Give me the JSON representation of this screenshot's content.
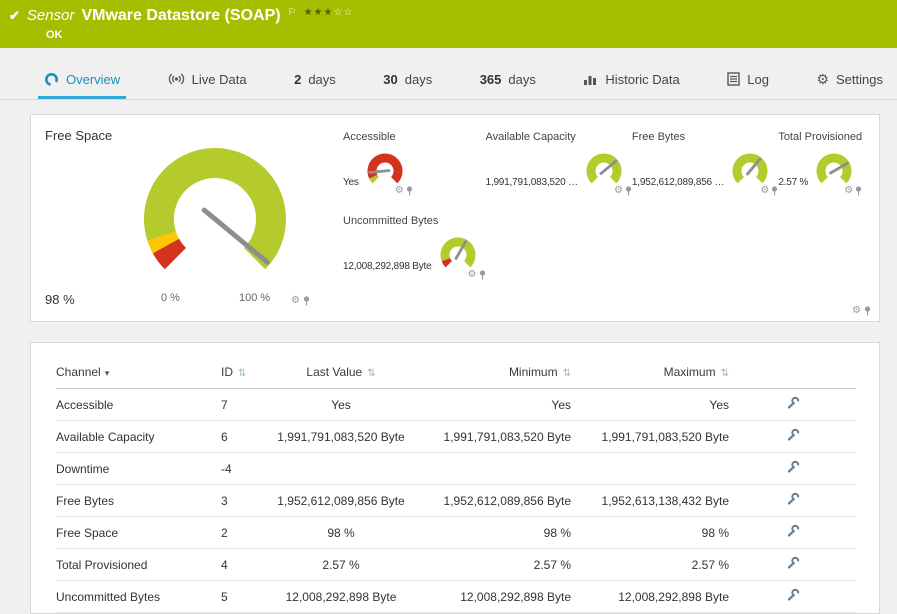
{
  "header": {
    "kind_label": "Sensor",
    "title": "VMware Datastore (SOAP)",
    "status": "OK",
    "priority_filled": "★★★",
    "priority_empty": "☆☆"
  },
  "tabs": [
    {
      "label": "Overview",
      "active": true
    },
    {
      "label": "Live Data"
    },
    {
      "value": "2",
      "label": "days"
    },
    {
      "value": "30",
      "label": "days"
    },
    {
      "value": "365",
      "label": "days"
    },
    {
      "label": "Historic Data"
    },
    {
      "label": "Log"
    },
    {
      "label": "Settings"
    }
  ],
  "gauges": {
    "main": {
      "label": "Free Space",
      "value": "98 %",
      "scale_min": "0 %",
      "scale_max": "100 %",
      "percent": 98
    },
    "accessible": {
      "label": "Accessible",
      "value": "Yes"
    },
    "available_capacity": {
      "label": "Available Capacity",
      "value": "1,991,791,083,520 …"
    },
    "free_bytes": {
      "label": "Free Bytes",
      "value": "1,952,612,089,856 …"
    },
    "total_provisioned": {
      "label": "Total Provisioned",
      "value": "2.57 %"
    },
    "uncommitted_bytes": {
      "label": "Uncommitted Bytes",
      "value": "12,008,292,898 Byte"
    }
  },
  "table": {
    "headers": {
      "channel": "Channel",
      "id": "ID",
      "last_value": "Last Value",
      "minimum": "Minimum",
      "maximum": "Maximum"
    },
    "rows": [
      {
        "channel": "Accessible",
        "id": "7",
        "last": "Yes",
        "min": "Yes",
        "max": "Yes"
      },
      {
        "channel": "Available Capacity",
        "id": "6",
        "last": "1,991,791,083,520 Byte",
        "min": "1,991,791,083,520 Byte",
        "max": "1,991,791,083,520 Byte"
      },
      {
        "channel": "Downtime",
        "id": "-4",
        "last": "",
        "min": "",
        "max": ""
      },
      {
        "channel": "Free Bytes",
        "id": "3",
        "last": "1,952,612,089,856 Byte",
        "min": "1,952,612,089,856 Byte",
        "max": "1,952,613,138,432 Byte"
      },
      {
        "channel": "Free Space",
        "id": "2",
        "last": "98 %",
        "min": "98 %",
        "max": "98 %"
      },
      {
        "channel": "Total Provisioned",
        "id": "4",
        "last": "2.57 %",
        "min": "2.57 %",
        "max": "2.57 %"
      },
      {
        "channel": "Uncommitted Bytes",
        "id": "5",
        "last": "12,008,292,898 Byte",
        "min": "12,008,292,898 Byte",
        "max": "12,008,292,898 Byte"
      }
    ]
  },
  "icons": {
    "check": "✔",
    "flag": "⚐",
    "gear": "⚙",
    "sort_both": "⇅",
    "sort_desc": "▾"
  },
  "colors": {
    "brand_green": "#A6BE00",
    "gauge_lime": "#B5CB2D",
    "gauge_red": "#D4331E",
    "gauge_yellow": "#FFC500",
    "active_tab_blue": "#2FA8D5"
  }
}
